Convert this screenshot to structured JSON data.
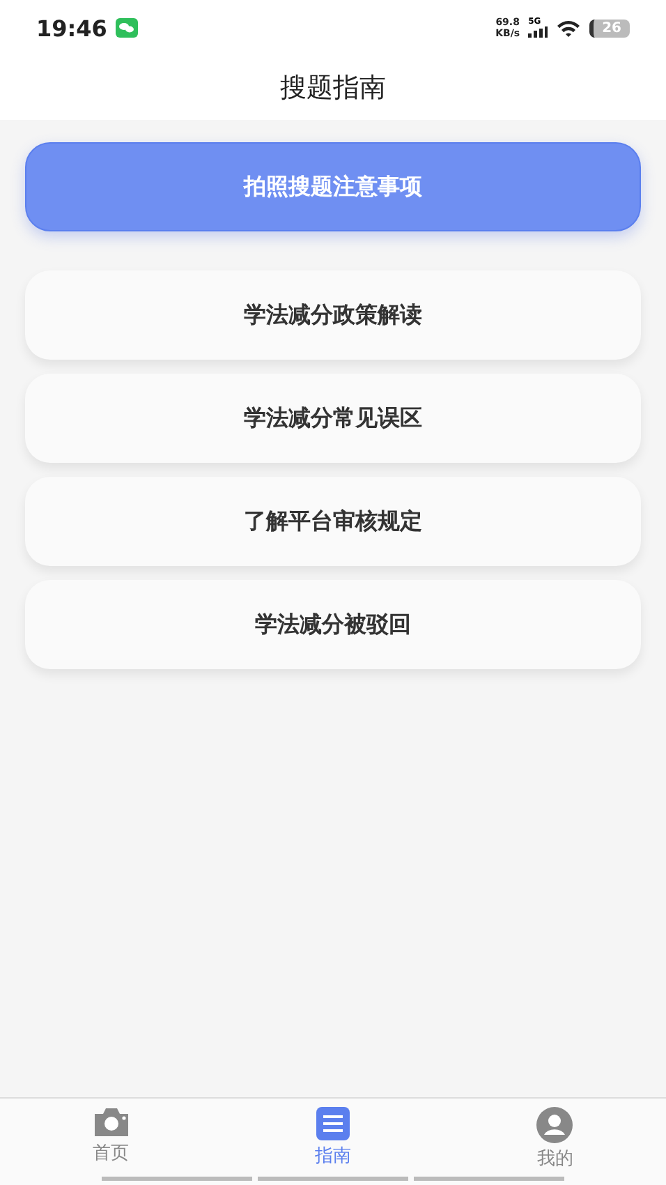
{
  "status_bar": {
    "time": "19:46",
    "speed": "69.8",
    "speed_unit": "KB/s",
    "network": "5G",
    "battery": "26"
  },
  "header": {
    "title": "搜题指南"
  },
  "items": [
    {
      "label": "拍照搜题注意事项",
      "selected": true
    },
    {
      "label": "学法减分政策解读",
      "selected": false
    },
    {
      "label": "学法减分常见误区",
      "selected": false
    },
    {
      "label": "了解平台审核规定",
      "selected": false
    },
    {
      "label": "学法减分被驳回",
      "selected": false
    }
  ],
  "tabs": [
    {
      "label": "首页",
      "kind": "camera",
      "selected": false
    },
    {
      "label": "指南",
      "kind": "list",
      "selected": true
    },
    {
      "label": "我的",
      "kind": "user",
      "selected": false
    }
  ]
}
